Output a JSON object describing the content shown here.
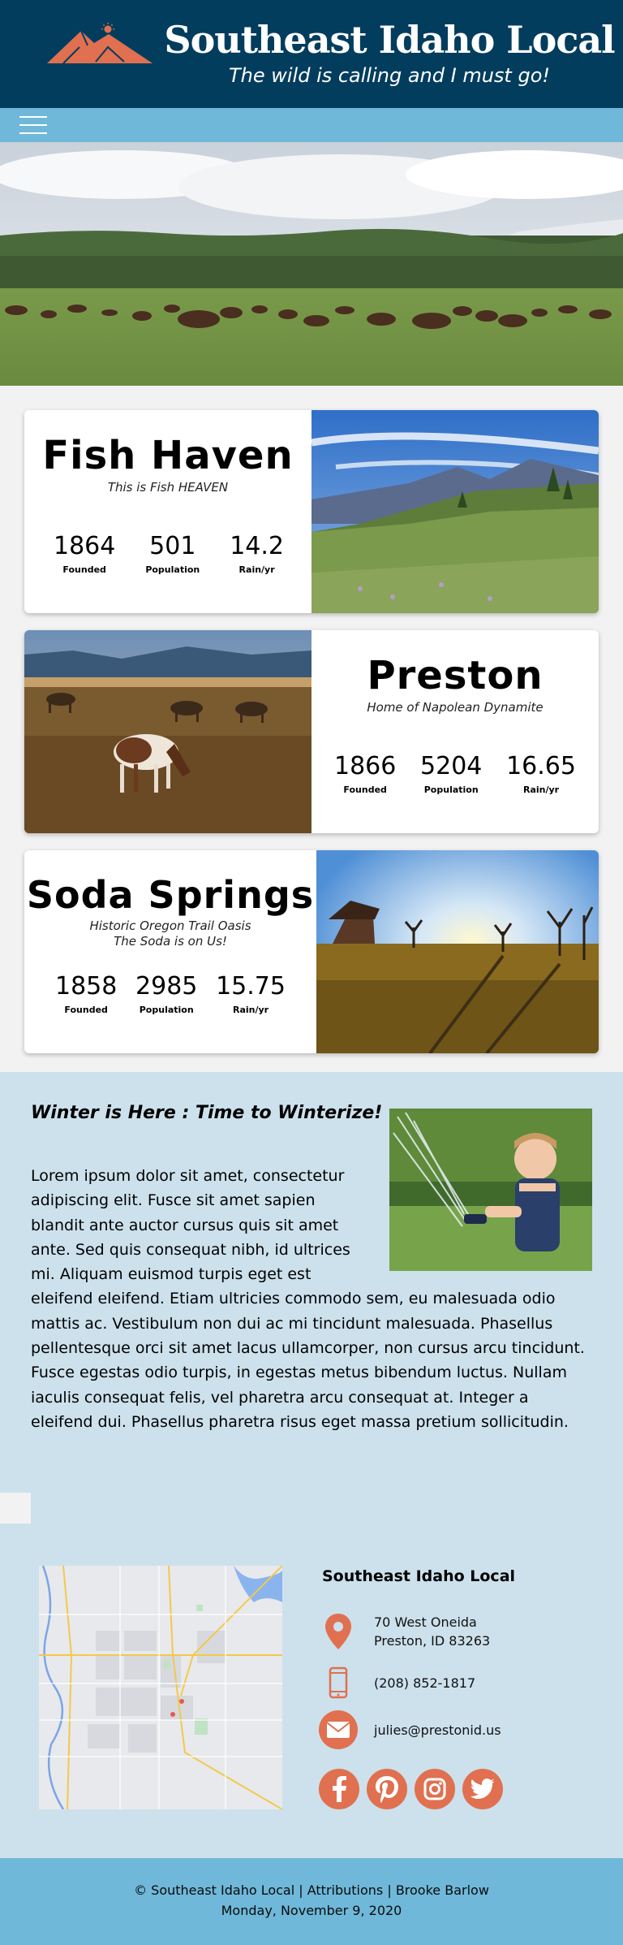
{
  "header": {
    "title": "Southeast Idaho Local",
    "tagline": "The wild is calling and I must go!"
  },
  "nav": {
    "menu_icon": "hamburger-menu-icon"
  },
  "hero": {
    "image": "bison herd grazing in meadow"
  },
  "towns": [
    {
      "name": "Fish Haven",
      "subtitle": [
        "This is Fish HEAVEN"
      ],
      "stats": [
        {
          "value": "1864",
          "label": "Founded"
        },
        {
          "value": "501",
          "label": "Population"
        },
        {
          "value": "14.2",
          "label": "Rain/yr"
        }
      ]
    },
    {
      "name": "Preston",
      "subtitle": [
        "Home of Napolean Dynamite"
      ],
      "stats": [
        {
          "value": "1866",
          "label": "Founded"
        },
        {
          "value": "5204",
          "label": "Population"
        },
        {
          "value": "16.65",
          "label": "Rain/yr"
        }
      ]
    },
    {
      "name": "Soda Springs",
      "subtitle": [
        "Historic Oregon Trail Oasis",
        "The Soda is on Us!"
      ],
      "stats": [
        {
          "value": "1858",
          "label": "Founded"
        },
        {
          "value": "2985",
          "label": "Population"
        },
        {
          "value": "15.75",
          "label": "Rain/yr"
        }
      ]
    }
  ],
  "article": {
    "heading": "Winter is Here : Time to Winterize!",
    "body": "Lorem ipsum dolor sit amet, consectetur adipiscing elit. Fusce sit amet sapien blandit ante auctor cursus quis sit amet ante. Sed quis consequat nibh, id ultrices mi. Aliquam euismod turpis eget est eleifend eleifend. Etiam ultricies commodo sem, eu malesuada odio mattis ac. Vestibulum non dui ac mi tincidunt malesuada. Phasellus pellentesque orci sit amet lacus ullamcorper, non cursus arcu tincidunt. Fusce egestas odio turpis, in egestas metus bibendum luctus. Nullam iaculis consequat felis, vel pharetra arcu consequat at. Integer a eleifend dui. Phasellus pharetra risus eget massa pretium sollicitudin."
  },
  "contact": {
    "title": "Southeast Idaho Local",
    "address_line1": "70 West Oneida",
    "address_line2": "Preston, ID 83263",
    "phone": "(208) 852-1817",
    "email": "julies@prestonid.us",
    "social_icons": [
      "facebook-icon",
      "pinterest-icon",
      "instagram-icon",
      "twitter-icon"
    ]
  },
  "footer": {
    "line1": "© Southeast Idaho Local | Attributions | Brooke Barlow",
    "line2": "Monday, November 9, 2020"
  },
  "colors": {
    "header_bg": "#033d5e",
    "nav_bg": "#6fb8d9",
    "accent": "#e07050",
    "section_bg": "#cce1ec"
  }
}
